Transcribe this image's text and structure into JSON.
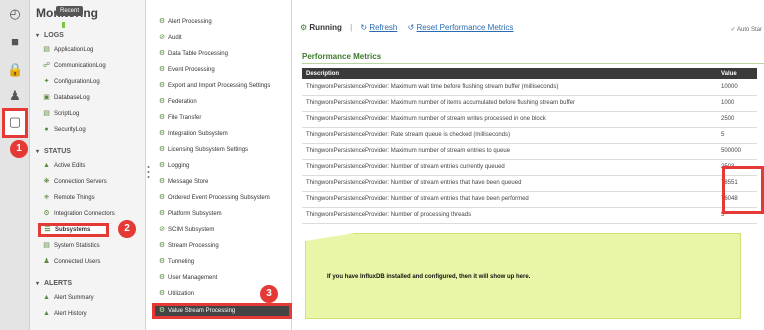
{
  "nav": {
    "title": "Monitoring",
    "tooltip": "Recent",
    "logs_header": "LOGS",
    "logs": [
      "ApplicationLog",
      "CommunicationLog",
      "ConfigurationLog",
      "DatabaseLog",
      "ScriptLog",
      "SecurityLog"
    ],
    "status_header": "STATUS",
    "status": [
      "Active Edits",
      "Connection Servers",
      "Remote Things",
      "Integration Connectors",
      "Subsystems",
      "System Statistics",
      "Connected Users"
    ],
    "alerts_header": "ALERTS",
    "alerts": [
      "Alert Summary",
      "Alert History"
    ]
  },
  "subsystems": [
    "Alert Processing",
    "Audit",
    "Data Table Processing",
    "Event Processing",
    "Export and Import Processing Settings",
    "Federation",
    "File Transfer",
    "Integration Subsystem",
    "Licensing Subsystem Settings",
    "Logging",
    "Message Store",
    "Ordered Event Processing Subsystem",
    "Platform Subsystem",
    "SCIM Subsystem",
    "Stream Processing",
    "Tunneling",
    "User Management",
    "Utilization",
    "Value Stream Processing"
  ],
  "toolbar": {
    "status": "Running",
    "refresh": "Refresh",
    "reset": "Reset Performance Metrics",
    "autostart": "Auto Star"
  },
  "metrics": {
    "title": "Performance Metrics",
    "col_description": "Description",
    "col_value": "Value",
    "rows": [
      {
        "d": "ThingworxPersistenceProvider: Maximum wait time before flushing stream buffer (milliseconds)",
        "v": "10000"
      },
      {
        "d": "ThingworxPersistenceProvider: Maximum number of items accumulated before flushing stream buffer",
        "v": "1000"
      },
      {
        "d": "ThingworxPersistenceProvider: Maximum number of stream writes processed in one block",
        "v": "2500"
      },
      {
        "d": "ThingworxPersistenceProvider: Rate stream queue is checked (milliseconds)",
        "v": "5"
      },
      {
        "d": "ThingworxPersistenceProvider: Maximum number of stream entries to queue",
        "v": "500000"
      },
      {
        "d": "ThingworxPersistenceProvider: Number of stream entries currently queued",
        "v": "2503"
      },
      {
        "d": "ThingworxPersistenceProvider: Number of stream entries that have been queued",
        "v": "78551"
      },
      {
        "d": "ThingworxPersistenceProvider: Number of stream entries that have been performed",
        "v": "76048"
      },
      {
        "d": "ThingworxPersistenceProvider: Number of processing threads",
        "v": "5"
      }
    ]
  },
  "note": "If you have InfluxDB installed and configured, then it will show up here.",
  "badges": [
    "1",
    "2",
    "3"
  ],
  "colors": {
    "highlight": "#e53935",
    "accent": "#3b7b2a",
    "link": "#2b6cb0"
  }
}
